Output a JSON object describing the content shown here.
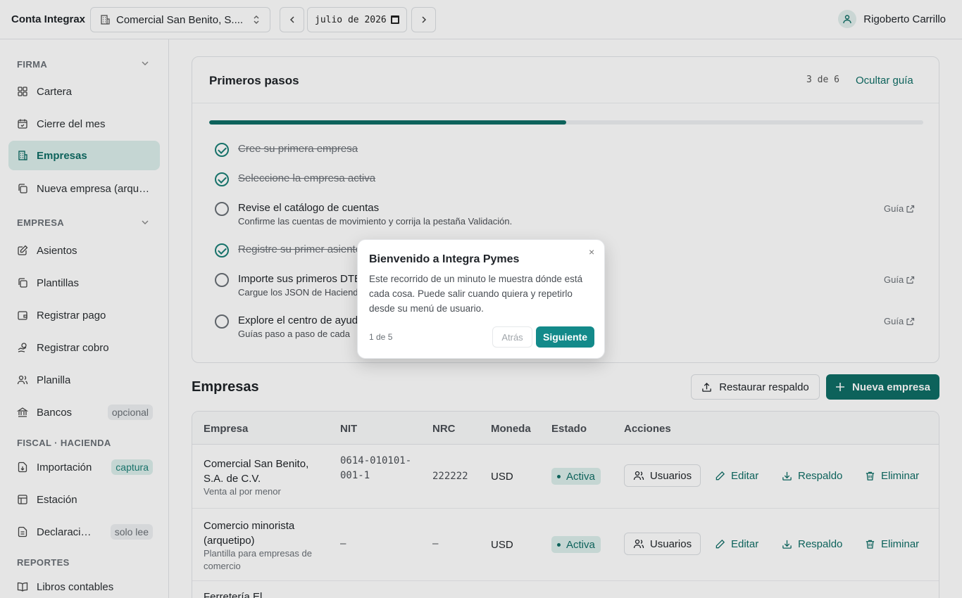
{
  "app": {
    "brand": "Conta Integrax"
  },
  "topbar": {
    "company": "Comercial San Benito, S....",
    "month": "julio de 2026",
    "user_name": "Rigoberto Carrillo"
  },
  "sidebar": {
    "sections": [
      {
        "title": "FIRMA"
      },
      {
        "title": "EMPRESA"
      },
      {
        "title": "FISCAL · HACIENDA"
      },
      {
        "title": "REPORTES"
      }
    ],
    "items": [
      {
        "label": "Cartera",
        "icon": "grid-icon"
      },
      {
        "label": "Cierre del mes",
        "icon": "calendar-check-icon"
      },
      {
        "label": "Empresas",
        "icon": "building-icon"
      },
      {
        "label": "Nueva empresa (arquetipo)",
        "icon": "copy-icon"
      },
      {
        "label": "Asientos",
        "icon": "edit-icon"
      },
      {
        "label": "Plantillas",
        "icon": "copy-icon"
      },
      {
        "label": "Registrar pago",
        "icon": "wallet-icon"
      },
      {
        "label": "Registrar cobro",
        "icon": "hand-coins-icon"
      },
      {
        "label": "Planilla",
        "icon": "users-icon"
      },
      {
        "label": "Bancos",
        "icon": "bank-icon",
        "badge": "opcional"
      },
      {
        "label": "Importación",
        "icon": "file-import-icon",
        "badge": "captura"
      },
      {
        "label": "Estación",
        "icon": "table-icon"
      },
      {
        "label": "Declaraciones",
        "icon": "file-text-icon",
        "badge": "solo lee"
      },
      {
        "label": "Libros contables",
        "icon": "book-icon"
      }
    ]
  },
  "guide": {
    "title": "Primeros pasos",
    "counter": "3 de 6",
    "hide_label": "Ocultar guía",
    "progress": 0.5,
    "guide_link": "Guía",
    "steps": [
      {
        "title": "Cree su primera empresa",
        "desc": ""
      },
      {
        "title": "Seleccione la empresa activa",
        "desc": ""
      },
      {
        "title": "Revise el catálogo de cuentas",
        "desc": "Confirme las cuentas de movimiento y corrija la pestaña Validación."
      },
      {
        "title": "Registre su primer asiento",
        "desc": ""
      },
      {
        "title": "Importe sus primeros DTE",
        "desc": "Cargue los JSON de Hacienda"
      },
      {
        "title": "Explore el centro de ayuda",
        "desc": "Guías paso a paso de cada"
      }
    ]
  },
  "companies": {
    "title": "Empresas",
    "restore_label": "Restaurar respaldo",
    "new_label": "Nueva empresa",
    "columns": [
      "Empresa",
      "NIT",
      "NRC",
      "Moneda",
      "Estado",
      "Acciones"
    ],
    "actions": {
      "users": "Usuarios",
      "edit": "Editar",
      "backup": "Respaldo",
      "delete": "Eliminar"
    },
    "rows": [
      {
        "name": "Comercial San Benito, S.A. de C.V.",
        "desc": "Venta al por menor",
        "nit": "0614-010101-001-1",
        "nrc": "222222",
        "currency": "USD",
        "status": "Activa"
      },
      {
        "name": "Comercio minorista (arquetipo)",
        "desc": "Plantilla para empresas de comercio",
        "nit": "–",
        "nrc": "–",
        "currency": "USD",
        "status": "Activa"
      },
      {
        "name": "Ferretería El",
        "desc": "",
        "nit": "",
        "nrc": "",
        "currency": "",
        "status": ""
      }
    ]
  },
  "tour": {
    "title": "Bienvenido a Integra Pymes",
    "body": "Este recorrido de un minuto le muestra dónde está cada cosa. Puede salir cuando quiera y repetirlo desde su menú de usuario.",
    "step": "1 de 5",
    "back": "Atrás",
    "next": "Siguiente",
    "close": "×"
  }
}
